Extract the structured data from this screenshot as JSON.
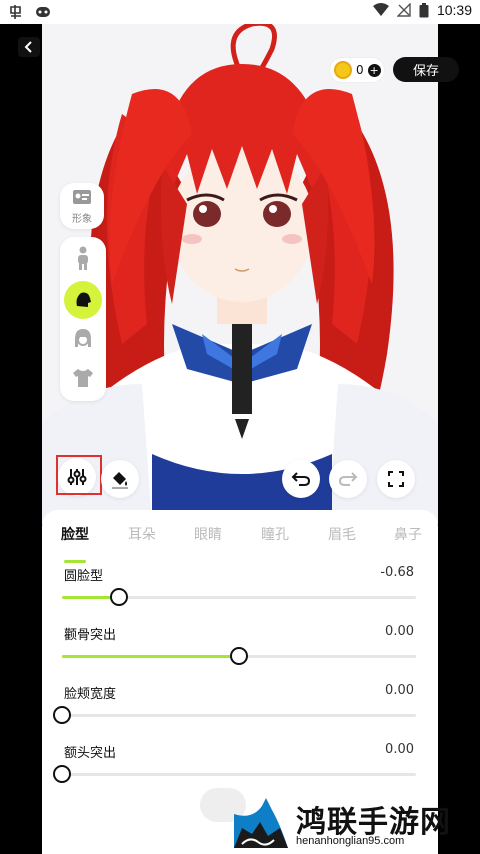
{
  "status_bar": {
    "time": "10:39"
  },
  "header": {
    "coin_count": "0",
    "coin_plus": "+",
    "save_label": "保存"
  },
  "sidebar": {
    "profile_label": "形象"
  },
  "tabs": [
    {
      "label": "脸型",
      "active": true
    },
    {
      "label": "耳朵",
      "active": false
    },
    {
      "label": "眼睛",
      "active": false
    },
    {
      "label": "瞳孔",
      "active": false
    },
    {
      "label": "眉毛",
      "active": false
    },
    {
      "label": "鼻子",
      "active": false
    }
  ],
  "sliders": [
    {
      "label": "圆脸型",
      "value": "-0.68",
      "fill": 0.16
    },
    {
      "label": "颧骨突出",
      "value": "0.00",
      "fill": 0.5
    },
    {
      "label": "脸颊宽度",
      "value": "0.00",
      "fill": 0.0
    },
    {
      "label": "额头突出",
      "value": "0.00",
      "fill": 0.0
    }
  ],
  "watermark": {
    "title": "鸿联手游网",
    "url": "henanhonglian95.com"
  },
  "colors": {
    "accent": "#a5e635",
    "hair": "#e0251e",
    "dark": "#111111"
  }
}
